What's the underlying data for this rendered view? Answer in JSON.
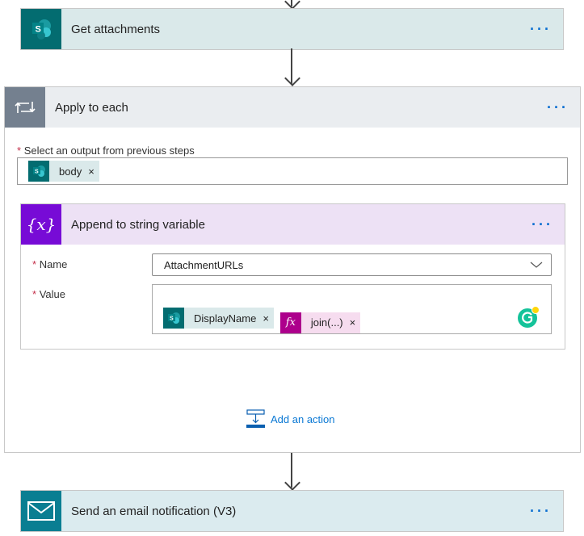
{
  "flow": {
    "get_attachments": {
      "title": "Get attachments",
      "icon": "sharepoint-icon",
      "menu": "···",
      "icon_color": "#036c70"
    },
    "apply_to_each": {
      "title": "Apply to each",
      "icon": "loop-icon",
      "menu": "···",
      "select_label": "Select an output from previous steps",
      "required_mark": "*",
      "tokens": [
        {
          "label": "body",
          "icon": "sharepoint-icon"
        }
      ],
      "icon_color": "#74808f"
    },
    "append": {
      "title": "Append to string variable",
      "icon": "variable-icon",
      "menu": "···",
      "name_label": "Name",
      "name_value": "AttachmentURLs",
      "value_label": "Value",
      "required_mark": "*",
      "tokens": [
        {
          "label": "DisplayName",
          "icon": "sharepoint-icon"
        },
        {
          "label": "join(...)",
          "icon": "fx-icon"
        }
      ],
      "icon_color": "#770bd6"
    },
    "add_action": {
      "label": "Add an action"
    },
    "send_email": {
      "title": "Send an email notification (V3)",
      "icon": "mail-icon",
      "menu": "···",
      "icon_color": "#0a7e92"
    }
  }
}
